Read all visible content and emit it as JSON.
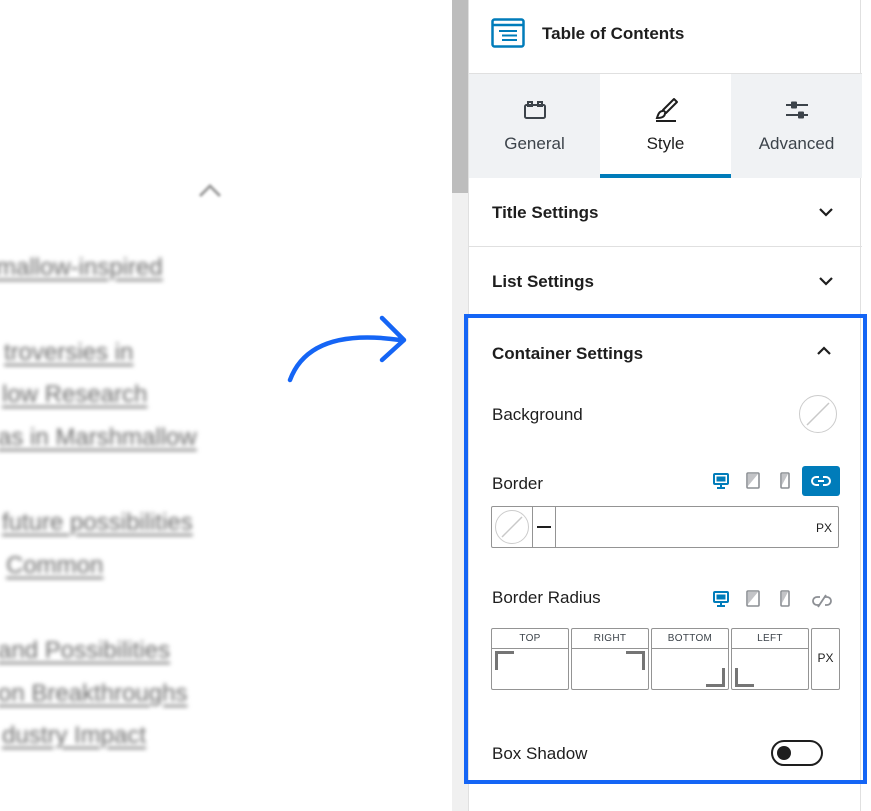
{
  "preview": {
    "links": [
      "mallow-inspired",
      "troversies in",
      "low Research",
      "as in Marshmallow",
      "future possibilities",
      "Common",
      "and Possibilities",
      "on Breakthroughs",
      "dustry Impact"
    ]
  },
  "panel": {
    "block_title": "Table of Contents",
    "tabs": [
      {
        "label": "General",
        "icon": "toolbox-icon"
      },
      {
        "label": "Style",
        "icon": "brush-icon",
        "active": true
      },
      {
        "label": "Advanced",
        "icon": "sliders-icon"
      }
    ],
    "sections": {
      "title_settings": "Title Settings",
      "list_settings": "List Settings",
      "container_settings": "Container Settings"
    },
    "container": {
      "background_label": "Background",
      "border_label": "Border",
      "border_unit": "PX",
      "border_radius_label": "Border Radius",
      "radius_fields": [
        "TOP",
        "RIGHT",
        "BOTTOM",
        "LEFT"
      ],
      "radius_unit": "PX",
      "box_shadow_label": "Box Shadow",
      "box_shadow_enabled": false
    }
  },
  "colors": {
    "accent": "#007cba",
    "highlight": "#1565f5",
    "arrow": "#1565f5"
  }
}
